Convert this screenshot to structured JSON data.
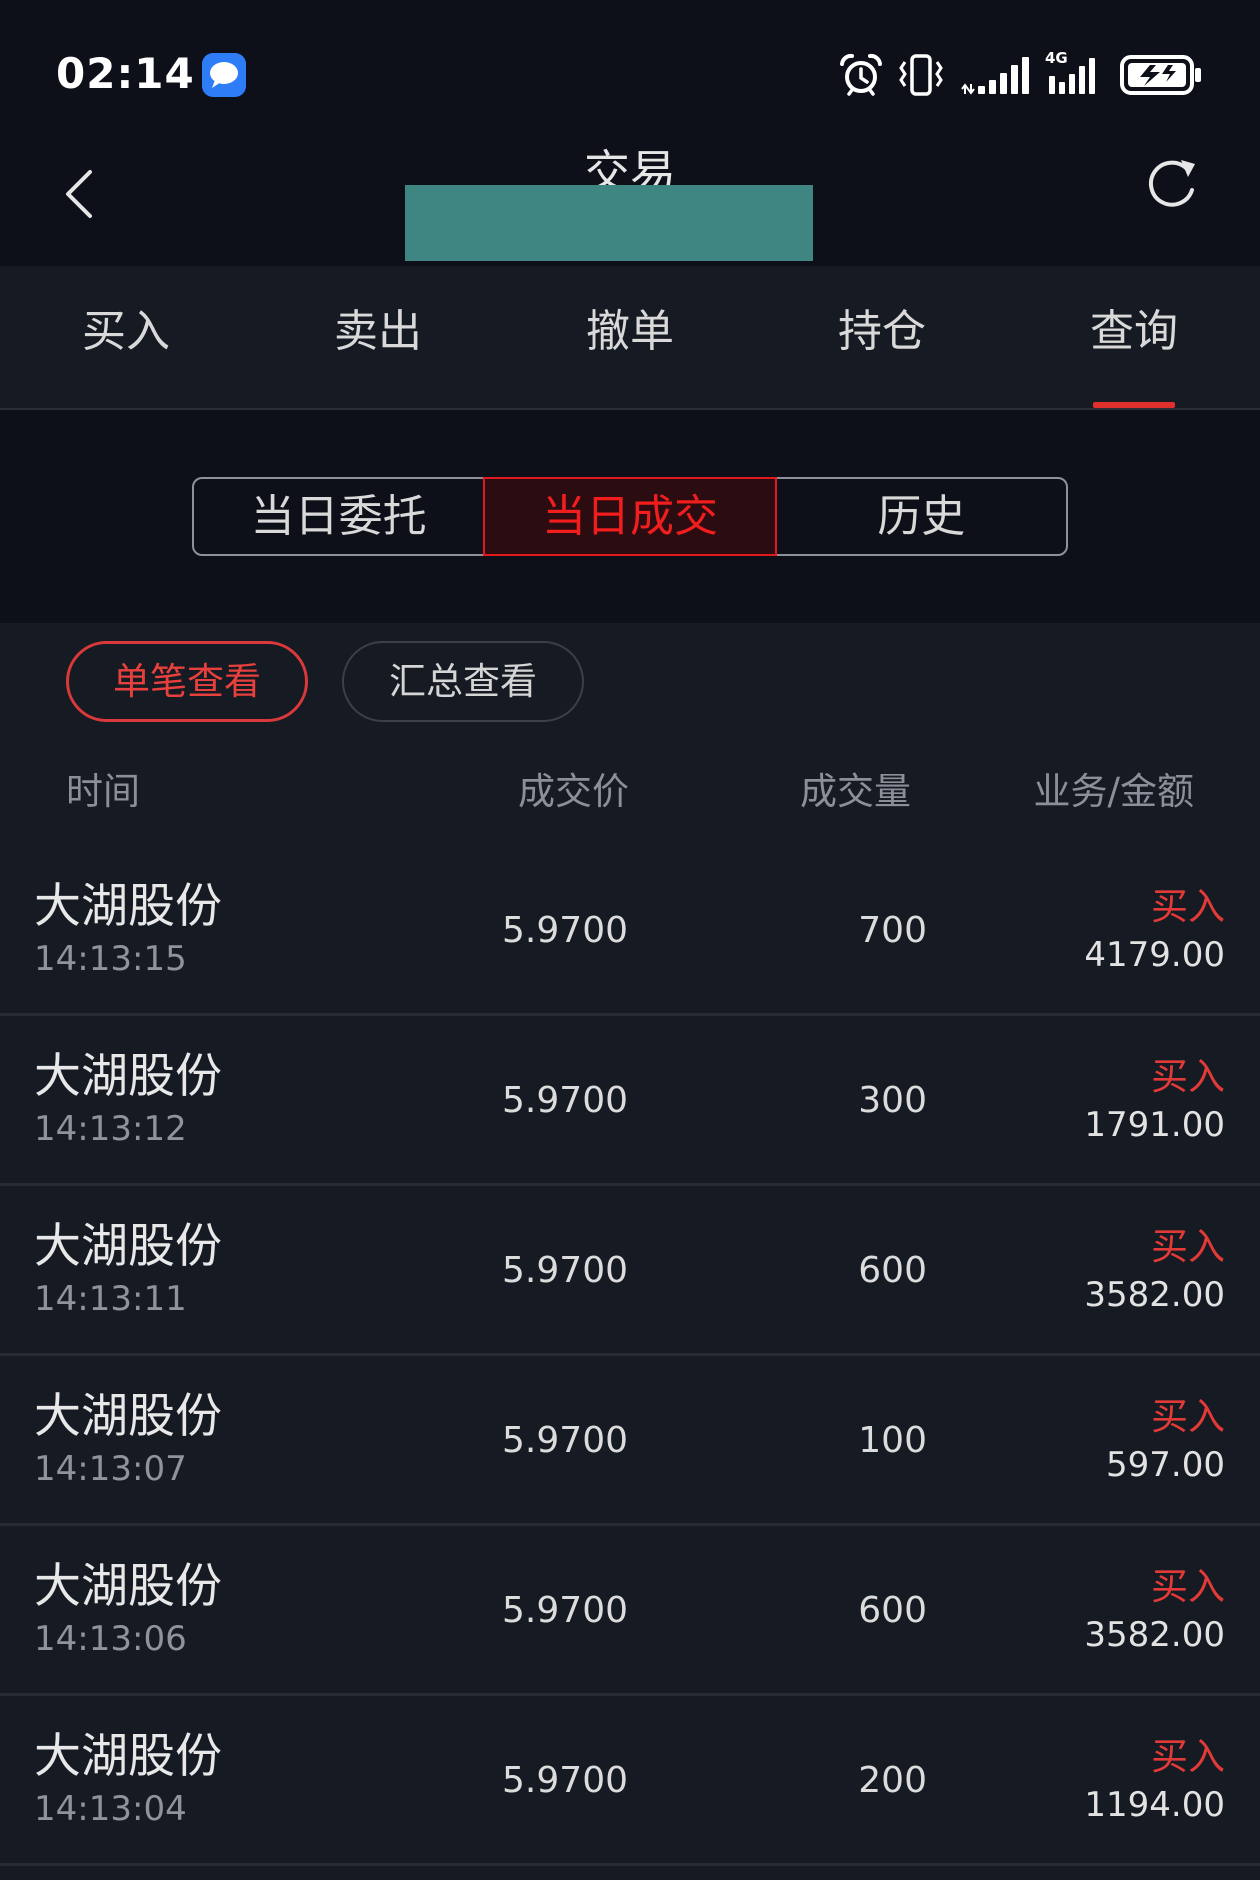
{
  "status_bar": {
    "time": "02:14",
    "network_type": "4G",
    "icons": [
      "message-icon",
      "alarm-icon",
      "vibrate-icon",
      "signal-icon",
      "4g-signal-icon",
      "battery-charging-icon"
    ]
  },
  "header": {
    "title": "交易",
    "back_icon": "chevron-left-icon",
    "refresh_icon": "refresh-icon"
  },
  "tabs": {
    "items": [
      {
        "label": "买入",
        "active": false
      },
      {
        "label": "卖出",
        "active": false
      },
      {
        "label": "撤单",
        "active": false
      },
      {
        "label": "持仓",
        "active": false
      },
      {
        "label": "查询",
        "active": true
      }
    ]
  },
  "query_segments": {
    "items": [
      {
        "label": "当日委托",
        "active": false
      },
      {
        "label": "当日成交",
        "active": true
      },
      {
        "label": "历史",
        "active": false
      }
    ]
  },
  "view_filters": {
    "items": [
      {
        "label": "单笔查看",
        "active": true
      },
      {
        "label": "汇总查看",
        "active": false
      }
    ]
  },
  "table": {
    "columns": {
      "time": "时间",
      "price": "成交价",
      "quantity": "成交量",
      "business_amount": "业务/金额"
    },
    "rows": [
      {
        "name": "大湖股份",
        "time": "14:13:15",
        "price": "5.9700",
        "quantity": "700",
        "side": "买入",
        "amount": "4179.00"
      },
      {
        "name": "大湖股份",
        "time": "14:13:12",
        "price": "5.9700",
        "quantity": "300",
        "side": "买入",
        "amount": "1791.00"
      },
      {
        "name": "大湖股份",
        "time": "14:13:11",
        "price": "5.9700",
        "quantity": "600",
        "side": "买入",
        "amount": "3582.00"
      },
      {
        "name": "大湖股份",
        "time": "14:13:07",
        "price": "5.9700",
        "quantity": "100",
        "side": "买入",
        "amount": "597.00"
      },
      {
        "name": "大湖股份",
        "time": "14:13:06",
        "price": "5.9700",
        "quantity": "600",
        "side": "买入",
        "amount": "3582.00"
      },
      {
        "name": "大湖股份",
        "time": "14:13:04",
        "price": "5.9700",
        "quantity": "200",
        "side": "买入",
        "amount": "1194.00"
      }
    ]
  },
  "colors": {
    "page_background": "#161a23",
    "header_background": "#0d1018",
    "accent_red": "#e0302e",
    "buy_red": "#e23a37",
    "text_primary": "#e6e6e6",
    "text_secondary": "#8b8f99",
    "redaction_teal": "#3f8582"
  }
}
